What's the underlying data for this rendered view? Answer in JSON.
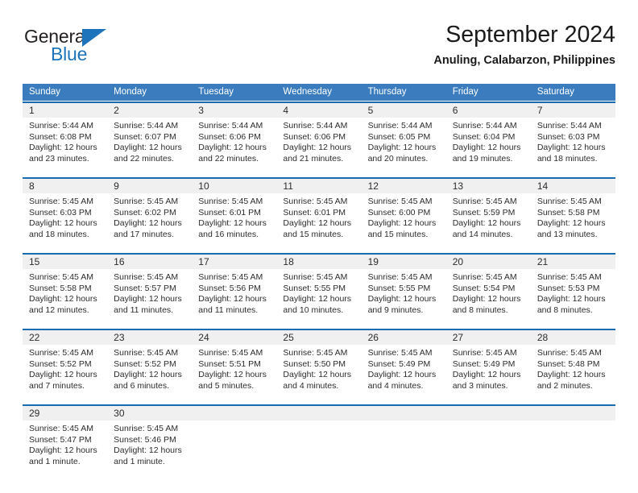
{
  "brand": {
    "logo_text_1": "General",
    "logo_text_2": "Blue",
    "logo_triangle_icon": "triangle-icon",
    "accent_color": "#1e74bb"
  },
  "header": {
    "title": "September 2024",
    "subtitle": "Anuling, Calabarzon, Philippines"
  },
  "colors": {
    "header_row_bg": "#3a7cbe",
    "week_top_border": "#1b6bb0",
    "daynum_band_bg": "#f0f0f0",
    "text": "#2c2c2c"
  },
  "weekdays": [
    "Sunday",
    "Monday",
    "Tuesday",
    "Wednesday",
    "Thursday",
    "Friday",
    "Saturday"
  ],
  "weeks": [
    {
      "daynums": [
        "1",
        "2",
        "3",
        "4",
        "5",
        "6",
        "7"
      ],
      "cells": [
        {
          "lines": [
            "Sunrise: 5:44 AM",
            "Sunset: 6:08 PM",
            "Daylight: 12 hours",
            "and 23 minutes."
          ]
        },
        {
          "lines": [
            "Sunrise: 5:44 AM",
            "Sunset: 6:07 PM",
            "Daylight: 12 hours",
            "and 22 minutes."
          ]
        },
        {
          "lines": [
            "Sunrise: 5:44 AM",
            "Sunset: 6:06 PM",
            "Daylight: 12 hours",
            "and 22 minutes."
          ]
        },
        {
          "lines": [
            "Sunrise: 5:44 AM",
            "Sunset: 6:06 PM",
            "Daylight: 12 hours",
            "and 21 minutes."
          ]
        },
        {
          "lines": [
            "Sunrise: 5:44 AM",
            "Sunset: 6:05 PM",
            "Daylight: 12 hours",
            "and 20 minutes."
          ]
        },
        {
          "lines": [
            "Sunrise: 5:44 AM",
            "Sunset: 6:04 PM",
            "Daylight: 12 hours",
            "and 19 minutes."
          ]
        },
        {
          "lines": [
            "Sunrise: 5:44 AM",
            "Sunset: 6:03 PM",
            "Daylight: 12 hours",
            "and 18 minutes."
          ]
        }
      ]
    },
    {
      "daynums": [
        "8",
        "9",
        "10",
        "11",
        "12",
        "13",
        "14"
      ],
      "cells": [
        {
          "lines": [
            "Sunrise: 5:45 AM",
            "Sunset: 6:03 PM",
            "Daylight: 12 hours",
            "and 18 minutes."
          ]
        },
        {
          "lines": [
            "Sunrise: 5:45 AM",
            "Sunset: 6:02 PM",
            "Daylight: 12 hours",
            "and 17 minutes."
          ]
        },
        {
          "lines": [
            "Sunrise: 5:45 AM",
            "Sunset: 6:01 PM",
            "Daylight: 12 hours",
            "and 16 minutes."
          ]
        },
        {
          "lines": [
            "Sunrise: 5:45 AM",
            "Sunset: 6:01 PM",
            "Daylight: 12 hours",
            "and 15 minutes."
          ]
        },
        {
          "lines": [
            "Sunrise: 5:45 AM",
            "Sunset: 6:00 PM",
            "Daylight: 12 hours",
            "and 15 minutes."
          ]
        },
        {
          "lines": [
            "Sunrise: 5:45 AM",
            "Sunset: 5:59 PM",
            "Daylight: 12 hours",
            "and 14 minutes."
          ]
        },
        {
          "lines": [
            "Sunrise: 5:45 AM",
            "Sunset: 5:58 PM",
            "Daylight: 12 hours",
            "and 13 minutes."
          ]
        }
      ]
    },
    {
      "daynums": [
        "15",
        "16",
        "17",
        "18",
        "19",
        "20",
        "21"
      ],
      "cells": [
        {
          "lines": [
            "Sunrise: 5:45 AM",
            "Sunset: 5:58 PM",
            "Daylight: 12 hours",
            "and 12 minutes."
          ]
        },
        {
          "lines": [
            "Sunrise: 5:45 AM",
            "Sunset: 5:57 PM",
            "Daylight: 12 hours",
            "and 11 minutes."
          ]
        },
        {
          "lines": [
            "Sunrise: 5:45 AM",
            "Sunset: 5:56 PM",
            "Daylight: 12 hours",
            "and 11 minutes."
          ]
        },
        {
          "lines": [
            "Sunrise: 5:45 AM",
            "Sunset: 5:55 PM",
            "Daylight: 12 hours",
            "and 10 minutes."
          ]
        },
        {
          "lines": [
            "Sunrise: 5:45 AM",
            "Sunset: 5:55 PM",
            "Daylight: 12 hours",
            "and 9 minutes."
          ]
        },
        {
          "lines": [
            "Sunrise: 5:45 AM",
            "Sunset: 5:54 PM",
            "Daylight: 12 hours",
            "and 8 minutes."
          ]
        },
        {
          "lines": [
            "Sunrise: 5:45 AM",
            "Sunset: 5:53 PM",
            "Daylight: 12 hours",
            "and 8 minutes."
          ]
        }
      ]
    },
    {
      "daynums": [
        "22",
        "23",
        "24",
        "25",
        "26",
        "27",
        "28"
      ],
      "cells": [
        {
          "lines": [
            "Sunrise: 5:45 AM",
            "Sunset: 5:52 PM",
            "Daylight: 12 hours",
            "and 7 minutes."
          ]
        },
        {
          "lines": [
            "Sunrise: 5:45 AM",
            "Sunset: 5:52 PM",
            "Daylight: 12 hours",
            "and 6 minutes."
          ]
        },
        {
          "lines": [
            "Sunrise: 5:45 AM",
            "Sunset: 5:51 PM",
            "Daylight: 12 hours",
            "and 5 minutes."
          ]
        },
        {
          "lines": [
            "Sunrise: 5:45 AM",
            "Sunset: 5:50 PM",
            "Daylight: 12 hours",
            "and 4 minutes."
          ]
        },
        {
          "lines": [
            "Sunrise: 5:45 AM",
            "Sunset: 5:49 PM",
            "Daylight: 12 hours",
            "and 4 minutes."
          ]
        },
        {
          "lines": [
            "Sunrise: 5:45 AM",
            "Sunset: 5:49 PM",
            "Daylight: 12 hours",
            "and 3 minutes."
          ]
        },
        {
          "lines": [
            "Sunrise: 5:45 AM",
            "Sunset: 5:48 PM",
            "Daylight: 12 hours",
            "and 2 minutes."
          ]
        }
      ]
    },
    {
      "daynums": [
        "29",
        "30",
        "",
        "",
        "",
        "",
        ""
      ],
      "cells": [
        {
          "lines": [
            "Sunrise: 5:45 AM",
            "Sunset: 5:47 PM",
            "Daylight: 12 hours",
            "and 1 minute."
          ]
        },
        {
          "lines": [
            "Sunrise: 5:45 AM",
            "Sunset: 5:46 PM",
            "Daylight: 12 hours",
            "and 1 minute."
          ]
        },
        {
          "lines": []
        },
        {
          "lines": []
        },
        {
          "lines": []
        },
        {
          "lines": []
        },
        {
          "lines": []
        }
      ]
    }
  ]
}
